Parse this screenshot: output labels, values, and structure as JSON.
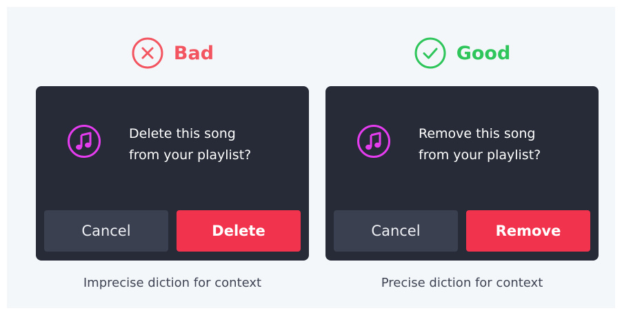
{
  "colors": {
    "background": "#f4f7fa",
    "bad": "#f35560",
    "good": "#2ec55a",
    "dialog": "#262b37",
    "cancel_button": "#3a4050",
    "action_button": "#f2334d",
    "music_icon": "#e63cf0"
  },
  "bad": {
    "verdict_icon": "x-circle-icon",
    "verdict_label": "Bad",
    "dialog": {
      "icon": "music-note-icon",
      "message_line1": "Delete this song",
      "message_line2": "from your playlist?",
      "cancel_label": "Cancel",
      "action_label": "Delete"
    },
    "caption": "Imprecise diction for context"
  },
  "good": {
    "verdict_icon": "check-circle-icon",
    "verdict_label": "Good",
    "dialog": {
      "icon": "music-note-icon",
      "message_line1": "Remove this song",
      "message_line2": "from your playlist?",
      "cancel_label": "Cancel",
      "action_label": "Remove"
    },
    "caption": "Precise diction for context"
  }
}
